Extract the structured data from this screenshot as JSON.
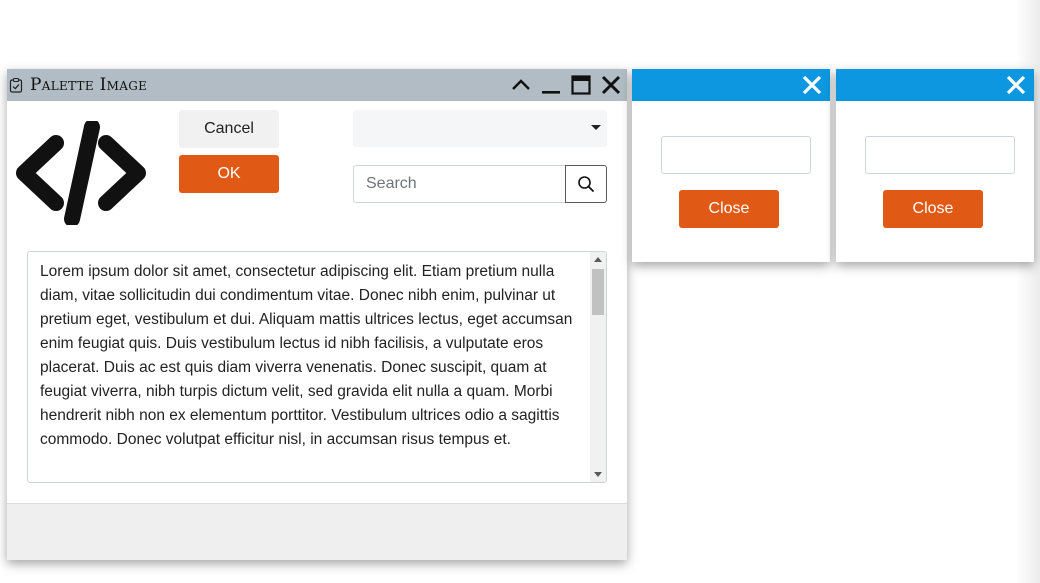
{
  "main_window": {
    "title": "Palette Image",
    "title_icon": "clipboard-check-icon",
    "controls": [
      "chevron-up-icon",
      "minimize-icon",
      "maximize-icon",
      "close-icon"
    ],
    "logo_icon": "code-icon",
    "cancel_label": "Cancel",
    "ok_label": "OK",
    "dropdown_value": "",
    "search_placeholder": "Search",
    "search_icon": "search-icon",
    "text_content": "Lorem ipsum dolor sit amet, consectetur adipiscing elit. Etiam pretium nulla diam, vitae sollicitudin dui condimentum vitae. Donec nibh enim, pulvinar ut pretium eget, vestibulum et dui. Aliquam mattis ultrices lectus, eget accumsan enim feugiat quis. Duis vestibulum lectus id nibh facilisis, a vulputate eros placerat. Duis ac est quis diam viverra venenatis. Donec suscipit, quam at feugiat viverra, nibh turpis dictum velit, sed gravida elit nulla a quam. Morbi hendrerit nibh non ex elementum porttitor. Vestibulum ultrices odio a sagittis commodo. Donec volutpat efficitur nisl, in accumsan risus tempus et."
  },
  "dialogs": [
    {
      "close_label": "Close",
      "input_value": "",
      "close_icon": "close-icon"
    },
    {
      "close_label": "Close",
      "input_value": "",
      "close_icon": "close-icon"
    }
  ],
  "colors": {
    "titlebar": "#b1bcc4",
    "dialog_header": "#0d97e0",
    "accent_button": "#e05a16"
  }
}
